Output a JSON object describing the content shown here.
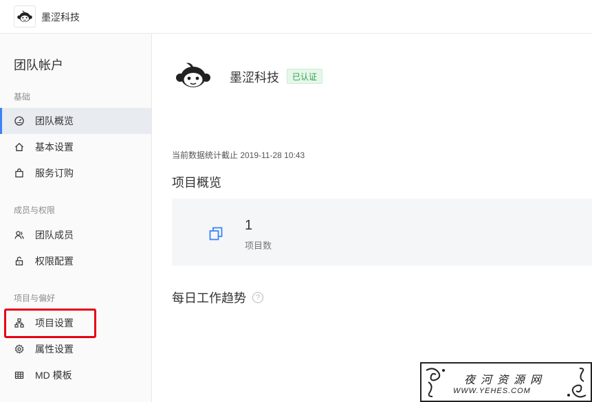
{
  "header": {
    "brand_name": "墨涩科技"
  },
  "sidebar": {
    "title": "团队帐户",
    "groups": [
      {
        "label": "基础",
        "items": [
          {
            "label": "团队概览",
            "icon": "dashboard-icon",
            "active": true
          },
          {
            "label": "基本设置",
            "icon": "home-icon"
          },
          {
            "label": "服务订购",
            "icon": "shopping-bag-icon"
          }
        ]
      },
      {
        "label": "成员与权限",
        "items": [
          {
            "label": "团队成员",
            "icon": "members-icon"
          },
          {
            "label": "权限配置",
            "icon": "unlock-icon"
          }
        ]
      },
      {
        "label": "项目与偏好",
        "items": [
          {
            "label": "项目设置",
            "icon": "sitemap-icon",
            "highlighted": true
          },
          {
            "label": "属性设置",
            "icon": "gear-icon"
          },
          {
            "label": "MD 模板",
            "icon": "table-icon"
          }
        ]
      }
    ]
  },
  "main": {
    "team_name": "墨涩科技",
    "verified_badge": "已认证",
    "stat_time": "当前数据统计截止 2019-11-28 10:43",
    "overview_title": "项目概览",
    "project_count": "1",
    "project_count_label": "项目数",
    "trend_title": "每日工作趋势",
    "help_icon_text": "?"
  },
  "watermark": {
    "text": "夜河资源网",
    "url": "WWW.YEHES.COM"
  },
  "colors": {
    "accent": "#3b82f6",
    "verified_green": "#2f9e4f",
    "highlight_red": "#e60012"
  }
}
